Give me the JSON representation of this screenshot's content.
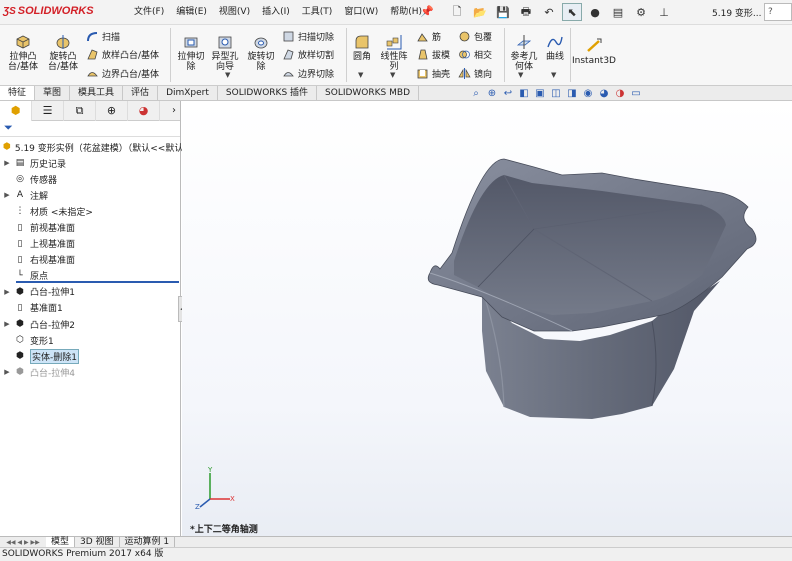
{
  "app": {
    "brand": "SOLIDWORKS",
    "doc_title": "5.19 变形...",
    "search": "?"
  },
  "menu": [
    "文件(F)",
    "编辑(E)",
    "视图(V)",
    "插入(I)",
    "工具(T)",
    "窗口(W)",
    "帮助(H)"
  ],
  "ribbon": {
    "extrude_boss": "拉伸凸\n台/基体",
    "revolve_boss": "旋转凸\n台/基体",
    "sweep": "扫描",
    "loft_boss": "放样凸台/基体",
    "boundary_boss": "边界凸台/基体",
    "extrude_cut": "拉伸切\n除",
    "hole_wizard": "异型孔\n向导",
    "revolve_cut": "旋转切\n除",
    "sweep_cut": "扫描切除",
    "loft_cut": "放样切割",
    "boundary_cut": "边界切除",
    "fillet": "圆角",
    "linear_pattern": "线性阵\n列",
    "rib": "筋",
    "draft": "拔模",
    "shell": "抽壳",
    "wrap": "包覆",
    "intersect": "相交",
    "mirror": "镜向",
    "ref_geometry": "参考几\n何体",
    "curves": "曲线",
    "instant3d": "Instant3D"
  },
  "tabs": [
    "特征",
    "草图",
    "模具工具",
    "评估",
    "DimXpert",
    "SOLIDWORKS 插件",
    "SOLIDWORKS MBD"
  ],
  "tree": {
    "root": "5.19 变形实例（花盆建模）（默认<<默认",
    "items": [
      {
        "label": "历史记录",
        "icon": "history-icon",
        "expand": true
      },
      {
        "label": "传感器",
        "icon": "sensor-icon",
        "expand": false
      },
      {
        "label": "注解",
        "icon": "annotation-icon",
        "expand": true
      },
      {
        "label": "材质 <未指定>",
        "icon": "material-icon",
        "expand": false
      },
      {
        "label": "前视基准面",
        "icon": "plane-icon",
        "expand": false
      },
      {
        "label": "上视基准面",
        "icon": "plane-icon",
        "expand": false
      },
      {
        "label": "右视基准面",
        "icon": "plane-icon",
        "expand": false
      },
      {
        "label": "原点",
        "icon": "origin-icon",
        "expand": false
      },
      {
        "label": "凸台-拉伸1",
        "icon": "extrude-icon",
        "expand": true
      },
      {
        "label": "基准面1",
        "icon": "plane-icon",
        "expand": false
      },
      {
        "label": "凸台-拉伸2",
        "icon": "extrude-icon",
        "expand": true
      },
      {
        "label": "变形1",
        "icon": "deform-icon",
        "expand": false
      },
      {
        "label": "实体-删除1",
        "icon": "delete-body-icon",
        "expand": false
      },
      {
        "label": "凸台-拉伸4",
        "icon": "extrude-icon",
        "expand": true
      }
    ]
  },
  "bottom_tabs": [
    "模型",
    "3D 视图",
    "运动算例 1"
  ],
  "view_label": "*上下二等角轴测",
  "status": "SOLIDWORKS Premium 2017 x64 版",
  "colors": {
    "brand": "#d32027",
    "accent": "#2a5bb0",
    "part": "#6e7483"
  }
}
